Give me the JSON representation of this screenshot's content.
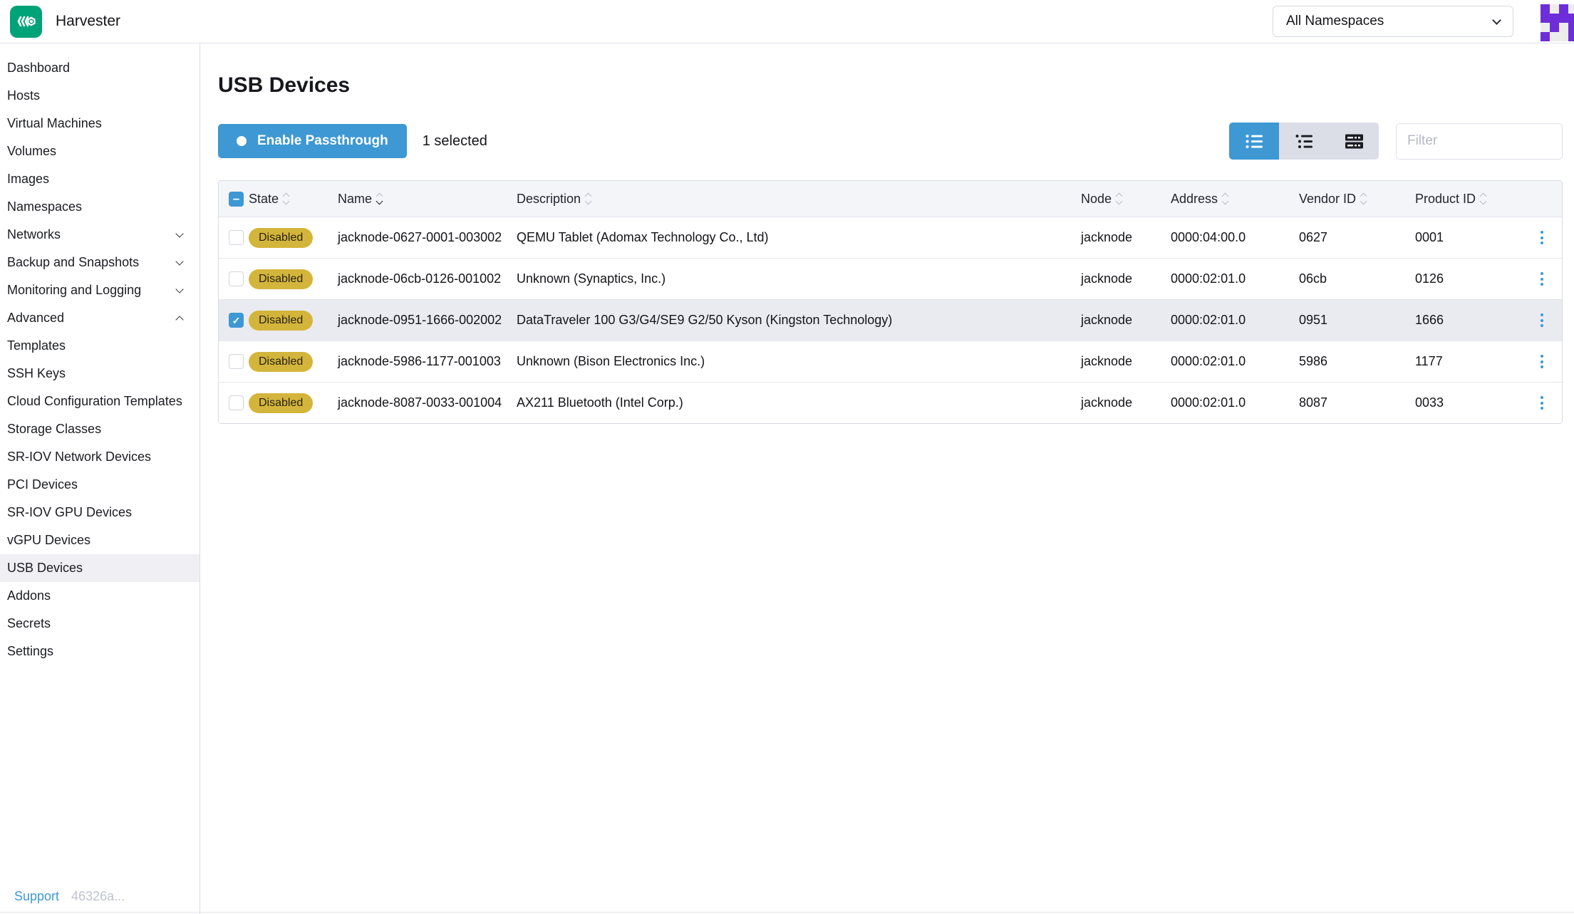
{
  "header": {
    "app_name": "Harvester",
    "logo_icon": "harvester-logo",
    "namespace_selector_value": "All Namespaces",
    "namespace_selector_icon": "chevron-down-icon",
    "avatar_icon": "identicon-avatar",
    "avatar_color": "#6d2ed9",
    "avatar_pattern": [
      [
        1,
        0,
        1,
        0
      ],
      [
        1,
        1,
        1,
        1
      ],
      [
        0,
        1,
        0,
        1
      ],
      [
        1,
        0,
        0,
        1
      ]
    ]
  },
  "sidebar": {
    "items": [
      {
        "label": "Dashboard"
      },
      {
        "label": "Hosts"
      },
      {
        "label": "Virtual Machines"
      },
      {
        "label": "Volumes"
      },
      {
        "label": "Images"
      },
      {
        "label": "Namespaces"
      },
      {
        "label": "Networks",
        "chevron": "down"
      },
      {
        "label": "Backup and Snapshots",
        "chevron": "down"
      },
      {
        "label": "Monitoring and Logging",
        "chevron": "down"
      },
      {
        "label": "Advanced",
        "chevron": "up"
      },
      {
        "label": "Templates"
      },
      {
        "label": "SSH Keys"
      },
      {
        "label": "Cloud Configuration Templates"
      },
      {
        "label": "Storage Classes"
      },
      {
        "label": "SR-IOV Network Devices"
      },
      {
        "label": "PCI Devices"
      },
      {
        "label": "SR-IOV GPU Devices"
      },
      {
        "label": "vGPU Devices"
      },
      {
        "label": "USB Devices",
        "selected": true
      },
      {
        "label": "Addons"
      },
      {
        "label": "Secrets"
      },
      {
        "label": "Settings"
      }
    ],
    "footer": {
      "support_label": "Support",
      "version": "46326a..."
    }
  },
  "main": {
    "title": "USB Devices",
    "enable_passthrough_label": "Enable Passthrough",
    "selected_count": "1 selected",
    "view_toggles": [
      {
        "icon": "list-view-icon",
        "active": true
      },
      {
        "icon": "grouped-list-view-icon",
        "active": false
      },
      {
        "icon": "flat-list-view-icon",
        "active": false
      }
    ],
    "filter_placeholder": "Filter",
    "table": {
      "header_checkbox_state": "indeterminate",
      "sorted_column": "Name",
      "columns": [
        "State",
        "Name",
        "Description",
        "Node",
        "Address",
        "Vendor ID",
        "Product ID"
      ],
      "rows": [
        {
          "checked": false,
          "state": "Disabled",
          "name": "jacknode-0627-0001-003002",
          "description": "QEMU Tablet (Adomax Technology Co., Ltd)",
          "node": "jacknode",
          "address": "0000:04:00.0",
          "vendor_id": "0627",
          "product_id": "0001"
        },
        {
          "checked": false,
          "state": "Disabled",
          "name": "jacknode-06cb-0126-001002",
          "description": "Unknown (Synaptics, Inc.)",
          "node": "jacknode",
          "address": "0000:02:01.0",
          "vendor_id": "06cb",
          "product_id": "0126"
        },
        {
          "checked": true,
          "state": "Disabled",
          "name": "jacknode-0951-1666-002002",
          "description": "DataTraveler 100 G3/G4/SE9 G2/50 Kyson (Kingston Technology)",
          "node": "jacknode",
          "address": "0000:02:01.0",
          "vendor_id": "0951",
          "product_id": "1666"
        },
        {
          "checked": false,
          "state": "Disabled",
          "name": "jacknode-5986-1177-001003",
          "description": "Unknown (Bison Electronics Inc.)",
          "node": "jacknode",
          "address": "0000:02:01.0",
          "vendor_id": "5986",
          "product_id": "1177"
        },
        {
          "checked": false,
          "state": "Disabled",
          "name": "jacknode-8087-0033-001004",
          "description": "AX211 Bluetooth (Intel Corp.)",
          "node": "jacknode",
          "address": "0000:02:01.0",
          "vendor_id": "8087",
          "product_id": "0033"
        }
      ]
    }
  },
  "colors": {
    "primary_blue": "#3d98d3",
    "badge_yellow": "#d4b53c",
    "brand_green": "#00a377",
    "selected_row_bg": "#eaebf0",
    "table_header_bg": "#f4f5f9"
  }
}
